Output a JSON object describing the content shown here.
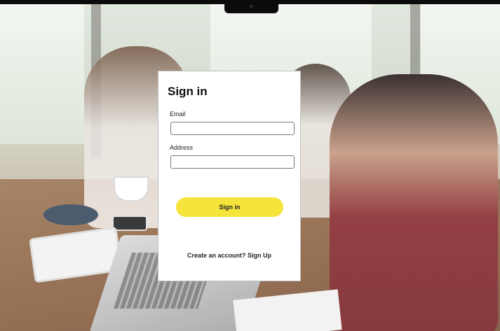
{
  "signin": {
    "title": "Sign in",
    "email_label": "Email",
    "email_value": "",
    "address_label": "Address",
    "address_value": "",
    "submit_label": "Sign in",
    "footer_prompt": "Create an account?",
    "footer_link": "Sign Up"
  },
  "colors": {
    "button": "#f5e43c",
    "card": "#ffffff"
  }
}
